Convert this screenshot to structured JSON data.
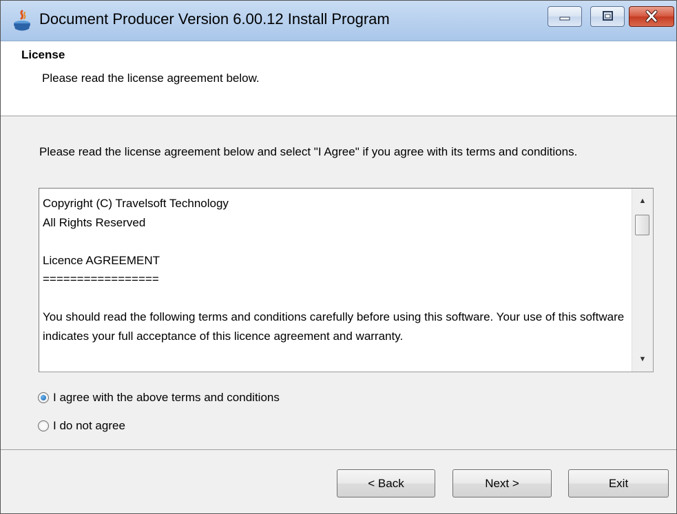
{
  "window": {
    "title": "Document Producer Version 6.00.12 Install Program",
    "minimize_glyph": "▭",
    "maximize_glyph": "▫",
    "close_glyph": "✕"
  },
  "header": {
    "title": "License",
    "subtitle": "Please read the license agreement below."
  },
  "instruction": "Please read the license agreement below and select \"I Agree\" if you agree with its terms and conditions.",
  "license": {
    "lines": [
      "Copyright (C) Travelsoft Technology",
      "All Rights Reserved",
      "",
      "Licence AGREEMENT",
      "=================",
      "",
      "You should read the following terms and conditions carefully before using this software. Your use of this software indicates your full acceptance of this licence agreement and warranty."
    ],
    "scroll_up_glyph": "▲",
    "scroll_down_glyph": "▼"
  },
  "options": {
    "agree_label": "I agree with the above terms and conditions",
    "disagree_label": "I do not agree",
    "selected": "agree"
  },
  "buttons": {
    "back_label": "< Back",
    "next_label": "Next >",
    "exit_label": "Exit"
  }
}
